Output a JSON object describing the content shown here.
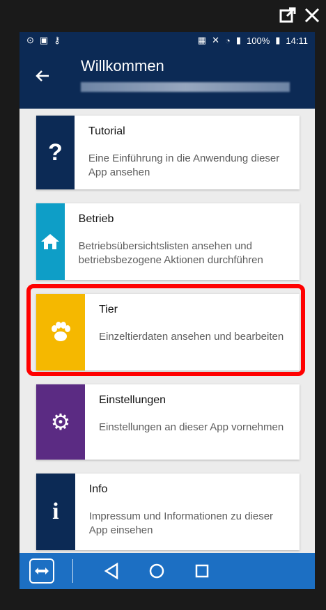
{
  "window_controls": {
    "popout_icon": "popout-icon",
    "close_icon": "close-icon"
  },
  "statusbar": {
    "battery": "100%",
    "time": "14:11"
  },
  "header": {
    "title": "Willkommen",
    "subtitle_obscured": "blurred-text"
  },
  "cards": [
    {
      "label": "Tutorial",
      "desc": "Eine Einführung in die Anwendung dieser App ansehen",
      "color": "#0c2a55",
      "icon": "question-icon"
    },
    {
      "label": "Betrieb",
      "desc": "Betriebsübersichtslisten ansehen und betriebsbezogene Aktionen durchführen",
      "color": "#0e9ec7",
      "icon": "home-icon"
    },
    {
      "label": "Tier",
      "desc": "Einzeltierdaten ansehen und bearbeiten",
      "color": "#f5b800",
      "icon": "paw-icon"
    },
    {
      "label": "Einstellungen",
      "desc": "Einstellungen an dieser App vornehmen",
      "color": "#5b2b83",
      "icon": "gears-icon"
    },
    {
      "label": "Info",
      "desc": "Impressum und Informationen zu dieser App einsehen",
      "color": "#0c2a55",
      "icon": "info-icon"
    }
  ],
  "navbar": {
    "icons": [
      "remote-icon",
      "back-triangle-icon",
      "home-circle-icon",
      "recents-square-icon"
    ],
    "color": "#1c6fc3"
  },
  "colors": {
    "appbar": "#0c2a55",
    "highlight": "#ff0000",
    "screen_bg": "#ececec"
  }
}
